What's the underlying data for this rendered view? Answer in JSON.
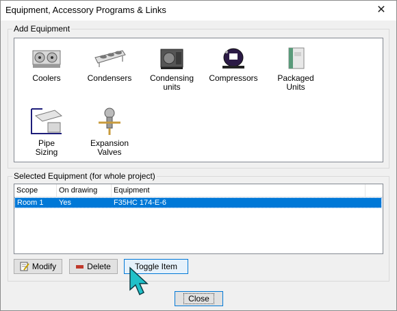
{
  "window": {
    "title": "Equipment, Accessory Programs & Links",
    "close_glyph": "✕"
  },
  "add_equipment": {
    "group_label": "Add Equipment",
    "items": [
      {
        "label": "Coolers",
        "icon": "cooler-icon"
      },
      {
        "label": "Condensers",
        "icon": "condenser-icon"
      },
      {
        "label": "Condensing\nunits",
        "icon": "condensing-unit-icon"
      },
      {
        "label": "Compressors",
        "icon": "compressor-icon"
      },
      {
        "label": "Packaged\nUnits",
        "icon": "packaged-unit-icon"
      },
      {
        "label": "Pipe\nSizing",
        "icon": "pipe-sizing-icon"
      },
      {
        "label": "Expansion\nValves",
        "icon": "expansion-valve-icon"
      }
    ]
  },
  "selected_equipment": {
    "group_label": "Selected Equipment (for whole project)",
    "columns": [
      "Scope",
      "On drawing",
      "Equipment"
    ],
    "rows": [
      {
        "scope": "Room 1",
        "on_drawing": "Yes",
        "equipment": "F35HC 174-E-6",
        "selected": true
      }
    ]
  },
  "buttons": {
    "modify": "Modify",
    "delete": "Delete",
    "toggle": "Toggle Item",
    "close": "Close"
  },
  "colors": {
    "selection": "#0078d7",
    "delete_icon": "#c0392b"
  }
}
